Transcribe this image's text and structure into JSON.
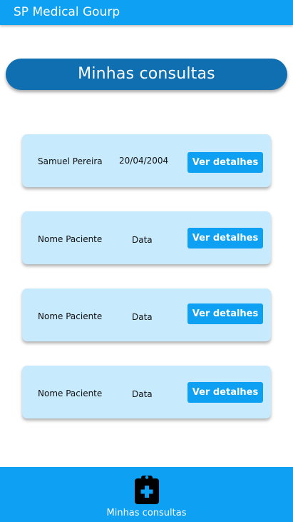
{
  "app": {
    "title": "SP Medical Gourp"
  },
  "header": {
    "title": "Minhas consultas"
  },
  "consultas": [
    {
      "name": "Samuel Pereira",
      "date": "20/04/2004",
      "button_label": "Ver detalhes"
    },
    {
      "name": "Nome Paciente",
      "date": "Data",
      "button_label": "Ver detalhes"
    },
    {
      "name": "Nome Paciente",
      "date": "Data",
      "button_label": "Ver detalhes"
    },
    {
      "name": "Nome Paciente",
      "date": "Data",
      "button_label": "Ver detalhes"
    }
  ],
  "bottom_nav": {
    "items": [
      {
        "label": "Minhas consultas",
        "icon": "clipboard-medical-icon"
      }
    ]
  },
  "colors": {
    "primary": "#0ea0f2",
    "header_pill": "#0f6fb0",
    "card_bg": "#c7eafd"
  }
}
